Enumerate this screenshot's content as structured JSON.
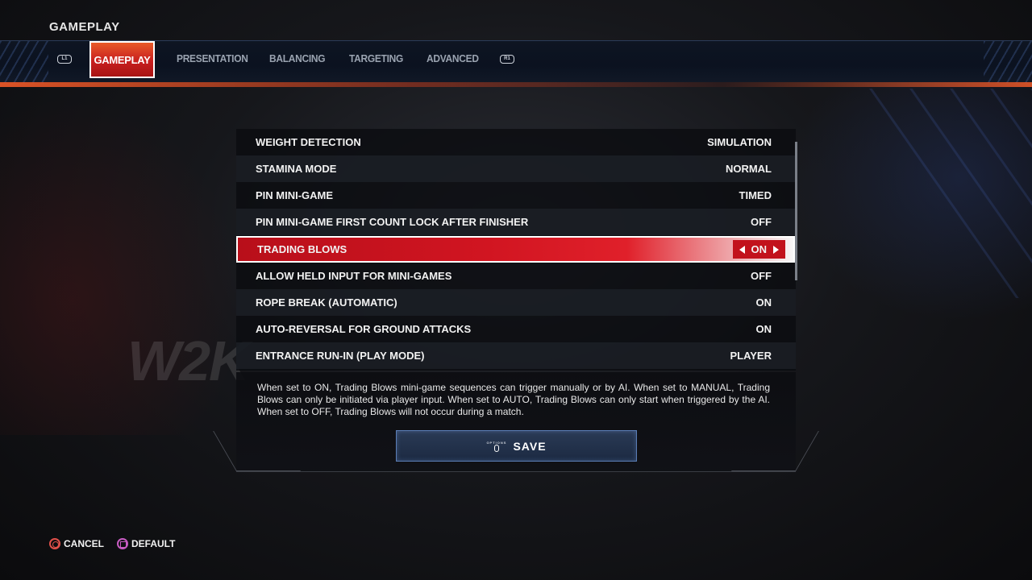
{
  "page_title": "GAMEPLAY",
  "tabs": {
    "left_bumper": "L1",
    "right_bumper": "R1",
    "items": [
      {
        "label": "GAMEPLAY"
      },
      {
        "label": "PRESENTATION"
      },
      {
        "label": "BALANCING"
      },
      {
        "label": "TARGETING"
      },
      {
        "label": "ADVANCED"
      }
    ]
  },
  "settings": [
    {
      "label": "WEIGHT DETECTION",
      "value": "SIMULATION"
    },
    {
      "label": "STAMINA MODE",
      "value": "NORMAL"
    },
    {
      "label": "PIN MINI-GAME",
      "value": "TIMED"
    },
    {
      "label": "PIN MINI-GAME FIRST COUNT LOCK AFTER FINISHER",
      "value": "OFF"
    },
    {
      "label": "TRADING BLOWS",
      "value": "ON"
    },
    {
      "label": "ALLOW HELD INPUT FOR MINI-GAMES",
      "value": "OFF"
    },
    {
      "label": "ROPE BREAK (AUTOMATIC)",
      "value": "ON"
    },
    {
      "label": "AUTO-REVERSAL FOR GROUND ATTACKS",
      "value": "ON"
    },
    {
      "label": "ENTRANCE RUN-IN (PLAY MODE)",
      "value": "PLAYER"
    }
  ],
  "description": "When set to ON, Trading Blows mini-game sequences can trigger manually or by AI. When set to MANUAL, Trading Blows can only be initiated via player input. When set to AUTO, Trading Blows can only start when triggered by the AI. When set to OFF, Trading Blows will not occur during a match.",
  "save_button": {
    "icon_label": "OPTIONS",
    "label": "SAVE"
  },
  "footer": {
    "cancel_label": "CANCEL",
    "default_label": "DEFAULT"
  },
  "background_logo": "W2K",
  "colors": {
    "accent_red": "#d11521",
    "accent_orange": "#e85a2a",
    "save_border": "#5a7db5"
  }
}
